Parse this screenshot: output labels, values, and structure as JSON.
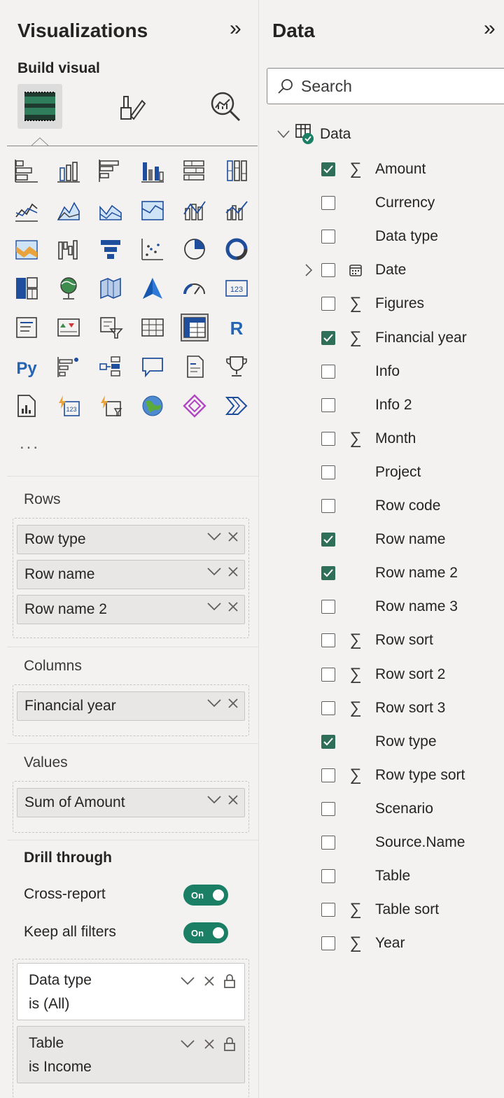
{
  "visualizations": {
    "title": "Visualizations",
    "build_visual": "Build visual",
    "more_label": "...",
    "wells": {
      "rows": {
        "label": "Rows",
        "fields": [
          "Row type",
          "Row name",
          "Row name 2"
        ]
      },
      "columns": {
        "label": "Columns",
        "fields": [
          "Financial year"
        ]
      },
      "values": {
        "label": "Values",
        "fields": [
          "Sum of Amount"
        ]
      }
    },
    "drill_through": {
      "title": "Drill through",
      "cross_report": {
        "label": "Cross-report",
        "state": "On"
      },
      "keep_all_filters": {
        "label": "Keep all filters",
        "state": "On"
      },
      "filters": [
        {
          "name": "Data type",
          "condition": "is (All)"
        },
        {
          "name": "Table",
          "condition": "is Income"
        }
      ]
    },
    "visual_icons": [
      "stacked-bar-icon",
      "stacked-column-icon",
      "clustered-bar-icon",
      "clustered-column-icon",
      "100-stacked-bar-icon",
      "100-stacked-column-icon",
      "line-chart-icon",
      "area-chart-icon",
      "stacked-area-icon",
      "100-stacked-area-icon",
      "line-stacked-column-icon",
      "line-clustered-column-icon",
      "ribbon-chart-icon",
      "waterfall-icon",
      "funnel-icon",
      "scatter-icon",
      "pie-chart-icon",
      "donut-chart-icon",
      "treemap-icon",
      "map-icon",
      "filled-map-icon",
      "azure-map-icon",
      "gauge-icon",
      "card-icon",
      "multi-row-card-icon",
      "kpi-icon",
      "slicer-icon",
      "table-icon",
      "matrix-icon",
      "r-visual-icon",
      "python-visual-icon",
      "key-influencers-icon",
      "decomposition-tree-icon",
      "qa-icon",
      "smart-narrative-icon",
      "metrics-icon",
      "paginated-report-icon",
      "power-apps-icon",
      "power-automate-icon",
      "arcgis-map-icon",
      "power-bi-visual-icon",
      "more-visual-icon"
    ]
  },
  "data": {
    "title": "Data",
    "search_placeholder": "Search",
    "table_name": "Data",
    "fields": [
      {
        "name": "Amount",
        "checked": true,
        "type": "sum"
      },
      {
        "name": "Currency",
        "checked": false,
        "type": ""
      },
      {
        "name": "Data type",
        "checked": false,
        "type": ""
      },
      {
        "name": "Date",
        "checked": false,
        "type": "calendar",
        "expandable": true
      },
      {
        "name": "Figures",
        "checked": false,
        "type": "sum"
      },
      {
        "name": "Financial year",
        "checked": true,
        "type": "sum"
      },
      {
        "name": "Info",
        "checked": false,
        "type": ""
      },
      {
        "name": "Info 2",
        "checked": false,
        "type": ""
      },
      {
        "name": "Month",
        "checked": false,
        "type": "sum"
      },
      {
        "name": "Project",
        "checked": false,
        "type": ""
      },
      {
        "name": "Row code",
        "checked": false,
        "type": ""
      },
      {
        "name": "Row name",
        "checked": true,
        "type": ""
      },
      {
        "name": "Row name 2",
        "checked": true,
        "type": ""
      },
      {
        "name": "Row name 3",
        "checked": false,
        "type": ""
      },
      {
        "name": "Row sort",
        "checked": false,
        "type": "sum"
      },
      {
        "name": "Row sort 2",
        "checked": false,
        "type": "sum"
      },
      {
        "name": "Row sort 3",
        "checked": false,
        "type": "sum"
      },
      {
        "name": "Row type",
        "checked": true,
        "type": ""
      },
      {
        "name": "Row type sort",
        "checked": false,
        "type": "sum"
      },
      {
        "name": "Scenario",
        "checked": false,
        "type": ""
      },
      {
        "name": "Source.Name",
        "checked": false,
        "type": ""
      },
      {
        "name": "Table",
        "checked": false,
        "type": ""
      },
      {
        "name": "Table sort",
        "checked": false,
        "type": "sum"
      },
      {
        "name": "Year",
        "checked": false,
        "type": "sum"
      }
    ]
  },
  "colors": {
    "accent": "#1a7f64",
    "checkbox": "#2f6f5a",
    "bar_blue": "#1f4e9c",
    "orange": "#e8a33d"
  }
}
